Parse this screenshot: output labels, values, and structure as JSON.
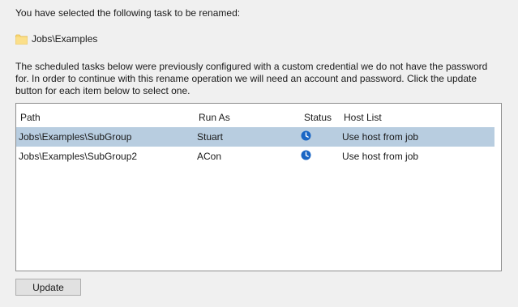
{
  "intro_text": "You have selected the following task to be renamed:",
  "selected_task": {
    "path": "Jobs\\Examples",
    "icon": "folder-icon"
  },
  "explanation": "The scheduled tasks below were previously configured with a custom credential we do not have the password for. In order to continue with this rename operation we will need an account and password. Click the update button for each item below to select one.",
  "table": {
    "columns": {
      "path": "Path",
      "run_as": "Run As",
      "status": "Status",
      "host_list": "Host List"
    },
    "rows": [
      {
        "path": "Jobs\\Examples\\SubGroup",
        "run_as": "Stuart",
        "status_icon": "clock-icon",
        "host_list": "Use host from job",
        "selected": true
      },
      {
        "path": "Jobs\\Examples\\SubGroup2",
        "run_as": "ACon",
        "status_icon": "clock-icon",
        "host_list": "Use host from job",
        "selected": false
      }
    ]
  },
  "update_button": "Update",
  "colors": {
    "selection": "#b8cde0",
    "status_icon": "#1a66c4",
    "folder": "#f8d775"
  }
}
